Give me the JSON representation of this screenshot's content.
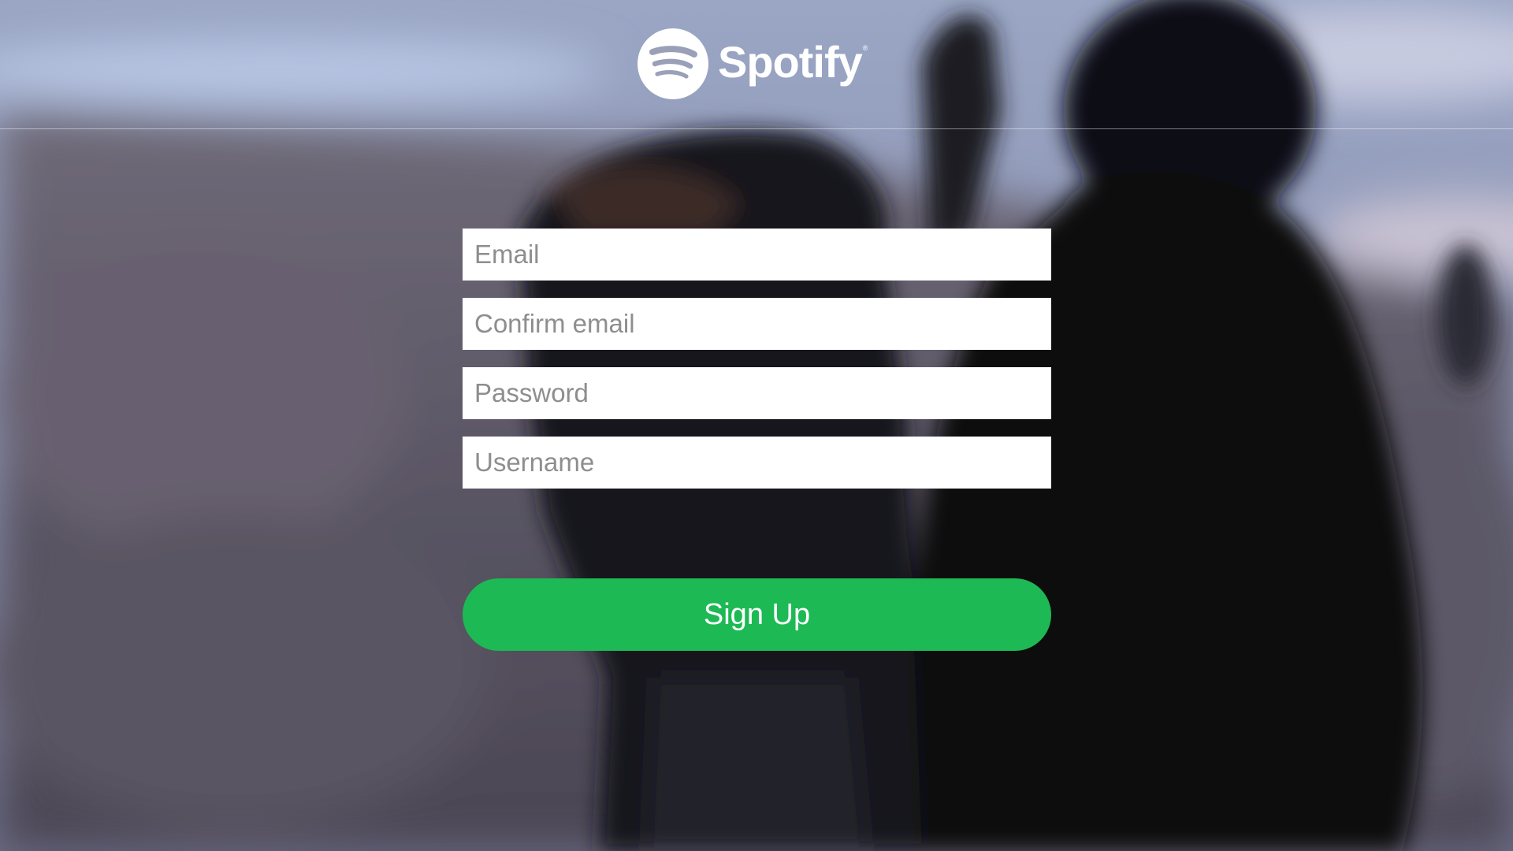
{
  "app": {
    "brand_name": "Spotify",
    "brand_mark": "®"
  },
  "colors": {
    "accent": "#1db954",
    "field_bg": "#ffffff",
    "placeholder": "#8e8e8e",
    "text_on_accent": "#ffffff"
  },
  "icons": {
    "logo": "spotify-logo-icon"
  },
  "form": {
    "email_placeholder": "Email",
    "confirm_email_placeholder": "Confirm email",
    "password_placeholder": "Password",
    "username_placeholder": "Username",
    "email_value": "",
    "confirm_email_value": "",
    "password_value": "",
    "username_value": ""
  },
  "actions": {
    "signup_label": "Sign Up"
  }
}
